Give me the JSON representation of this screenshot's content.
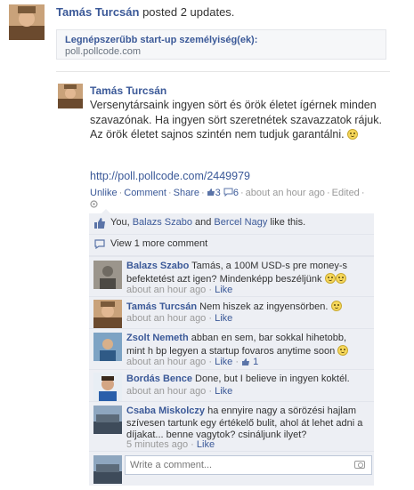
{
  "story": {
    "author": "Tamás Turcsán",
    "action": " posted 2 updates.",
    "attachment_title": "Legnépszerűbb start-up személyiség(ek):",
    "attachment_url": "poll.pollcode.com"
  },
  "post": {
    "author": "Tamás Turcsán",
    "text": "Versenytársaink ingyen sört és örök életet ígérnek minden szavazónak. Ha ingyen sört szeretnétek szavazzatok rájuk. Az örök életet sajnos szintén nem tudjuk garantálni.",
    "link": "http://poll.pollcode.com/2449979",
    "actions": {
      "unlike": "Unlike",
      "comment": "Comment",
      "share": "Share",
      "likes_count": "3",
      "comments_count": "6",
      "time": "about an hour ago",
      "edited": "Edited"
    }
  },
  "likes_row": {
    "you": "You, ",
    "user1": "Balazs Szabo",
    "and": " and ",
    "user2": "Bercel Nagy",
    "rest": " like this."
  },
  "view_more": "View 1 more comment",
  "comments": [
    {
      "name": "Balazs Szabo",
      "text": "Tamás, a 100M USD-s pre money-s befektetést azt igen? Mindenképp beszéljünk",
      "time": "about an hour ago",
      "like": "Like"
    },
    {
      "name": "Tamás Turcsán",
      "text": "Nem hiszek az ingyensörben.",
      "time": "about an hour ago",
      "like": "Like"
    },
    {
      "name": "Zsolt Nemeth",
      "text": "abban en sem, bar sokkal hihetobb, mint h bp legyen a startup fovaros anytime soon",
      "time": "about an hour ago",
      "like": "Like",
      "likes": "1"
    },
    {
      "name": "Bordás Bence",
      "text": "Done, but I believe in ingyen koktél.",
      "time": "about an hour ago",
      "like": "Like"
    },
    {
      "name": "Csaba Miskolczy",
      "text": "ha ennyire nagy a sörözési hajlam szívesen tartunk egy értékelő bulit, ahol át lehet adni a díjakat... benne vagytok? csináljunk ilyet?",
      "time": "5 minutes ago",
      "like": "Like"
    }
  ],
  "write_placeholder": "Write a comment...",
  "colors": {
    "link": "#3b5998",
    "panel": "#edeff4"
  }
}
